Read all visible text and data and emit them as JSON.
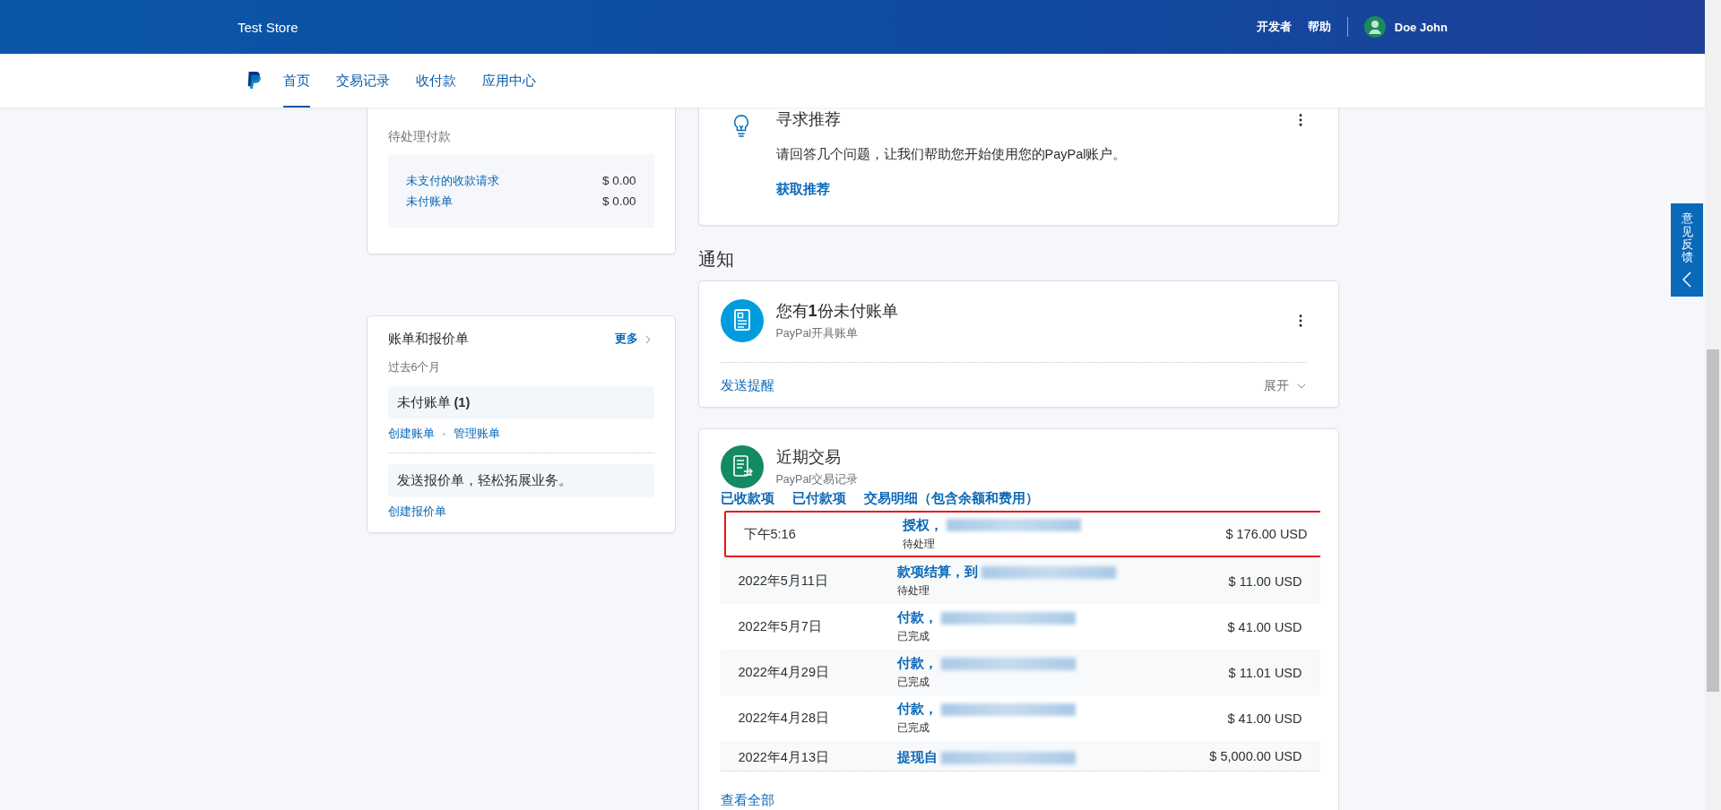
{
  "header": {
    "store_name": "Test Store",
    "links": [
      "开发者",
      "帮助"
    ],
    "user_name": "Doe John"
  },
  "nav": {
    "tabs": [
      {
        "label": "首页",
        "selected": true
      },
      {
        "label": "交易记录",
        "selected": false
      },
      {
        "label": "收付款",
        "selected": false
      },
      {
        "label": "应用中心",
        "selected": false
      }
    ]
  },
  "pending_card": {
    "label": "待处理付款",
    "rows": [
      {
        "label": "未支付的收款请求",
        "amount": "$ 0.00"
      },
      {
        "label": "未付账单",
        "amount": "$ 0.00"
      }
    ]
  },
  "invoices_card": {
    "title": "账单和报价单",
    "more": "更多",
    "period": "过去6个月",
    "unpaid": "未付账单 **(1)**",
    "links": [
      "创建账单",
      "管理账单"
    ],
    "promo": "发送报价单，轻松拓展业务。",
    "promo_link": "创建报价单"
  },
  "recommend_card": {
    "title": "寻求推荐",
    "text": "请回答几个问题，让我们帮助您开始使用您的PayPal账户。",
    "link": "获取推荐"
  },
  "notifications": {
    "heading": "通知",
    "title": "您有**1**份未付账单",
    "subtitle": "PayPal开具账单",
    "action": "发送提醒",
    "expand": "展开"
  },
  "transactions": {
    "title": "近期交易",
    "subtitle": "PayPal交易记录",
    "filters": [
      "已收款项",
      "已付款项",
      "交易明细（包含余额和费用）"
    ],
    "rows": [
      {
        "date": "下午5:16",
        "desc": "授权，",
        "status": "待处理",
        "amount": "$ 176.00 USD",
        "highlighted": true
      },
      {
        "date": "2022年5月11日",
        "desc": "款项结算，到",
        "status": "待处理",
        "amount": "$ 11.00 USD",
        "highlighted": false
      },
      {
        "date": "2022年5月7日",
        "desc": "付款，",
        "status": "已完成",
        "amount": "$ 41.00 USD",
        "highlighted": false
      },
      {
        "date": "2022年4月29日",
        "desc": "付款，",
        "status": "已完成",
        "amount": "$ 11.01 USD",
        "highlighted": false
      },
      {
        "date": "2022年4月28日",
        "desc": "付款，",
        "status": "已完成",
        "amount": "$ 41.00 USD",
        "highlighted": false
      },
      {
        "date": "2022年4月13日",
        "desc": "提现自",
        "amount": "$ 5,000.00 USD",
        "highlighted": false
      }
    ],
    "view_all": "查看全部"
  },
  "feedback_tab": {
    "label": "意见反馈"
  }
}
